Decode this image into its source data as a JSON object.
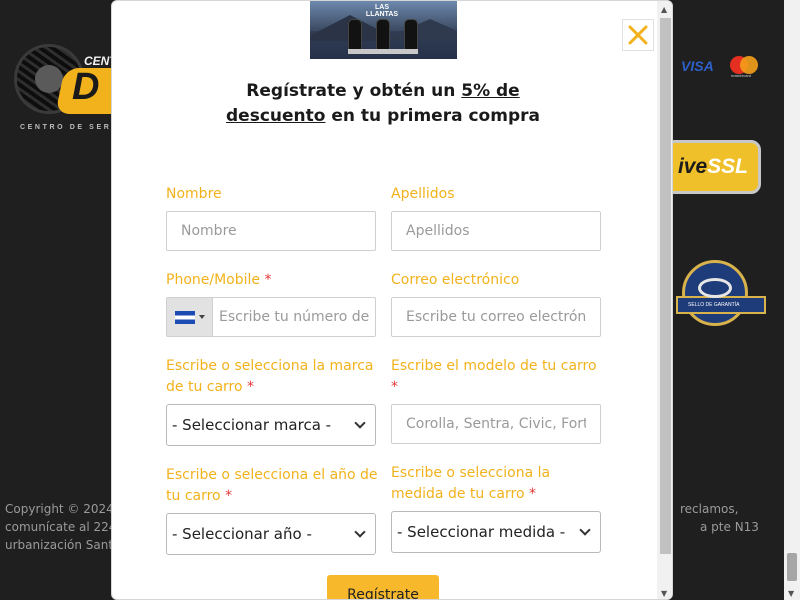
{
  "background": {
    "logo_top_text": "CENT",
    "logo_letter": "D",
    "logo_tagline": "CENTRO DE SERVIC",
    "payment_visa": "VISA",
    "payment_mastercard": "mastercard",
    "ssl_badge": {
      "pre": "ive",
      "bold": "SSL"
    },
    "seal_text": "SELLO DE GARANTÍA",
    "copyright_lines": [
      "Copyright © 2024",
      "comunícate al 224",
      "urbanización Sant"
    ],
    "right_lines": [
      "reclamos,",
      "a pte N13",
      ""
    ]
  },
  "modal": {
    "banner_text": "LAS LLANTAS",
    "close_icon": "close-icon",
    "title": {
      "part1": "Regístrate y obtén un ",
      "discount": "5% de descuento",
      "part2": " en tu primera compra"
    },
    "fields": {
      "nombre": {
        "label": "Nombre",
        "placeholder": "Nombre"
      },
      "apellidos": {
        "label": "Apellidos",
        "placeholder": "Apellidos"
      },
      "phone": {
        "label": "Phone/Mobile",
        "required": "*",
        "placeholder": "Escribe tu número de",
        "flag_icon": "el-salvador-flag-icon"
      },
      "correo": {
        "label": "Correo electrónico",
        "placeholder": "Escribe tu correo electróni"
      },
      "marca": {
        "label": "Escribe o selecciona la marca de tu carro",
        "required": "*",
        "selected": "- Seleccionar marca -"
      },
      "modelo": {
        "label": "Escribe el modelo de tu carro",
        "required": "*",
        "placeholder": "Corolla, Sentra, Civic, Forte"
      },
      "anio": {
        "label": "Escribe o selecciona el año de tu carro",
        "required": "*",
        "selected": "- Seleccionar año -"
      },
      "medida": {
        "label": "Escribe o selecciona la medida de tu carro",
        "required": "*",
        "selected": "- Seleccionar medida -"
      }
    },
    "submit_label": "Regístrate"
  },
  "colors": {
    "label": "#f2b21c",
    "required": "#e23a3a",
    "button": "#f7b92b",
    "page_bg": "#1f1f1f"
  }
}
